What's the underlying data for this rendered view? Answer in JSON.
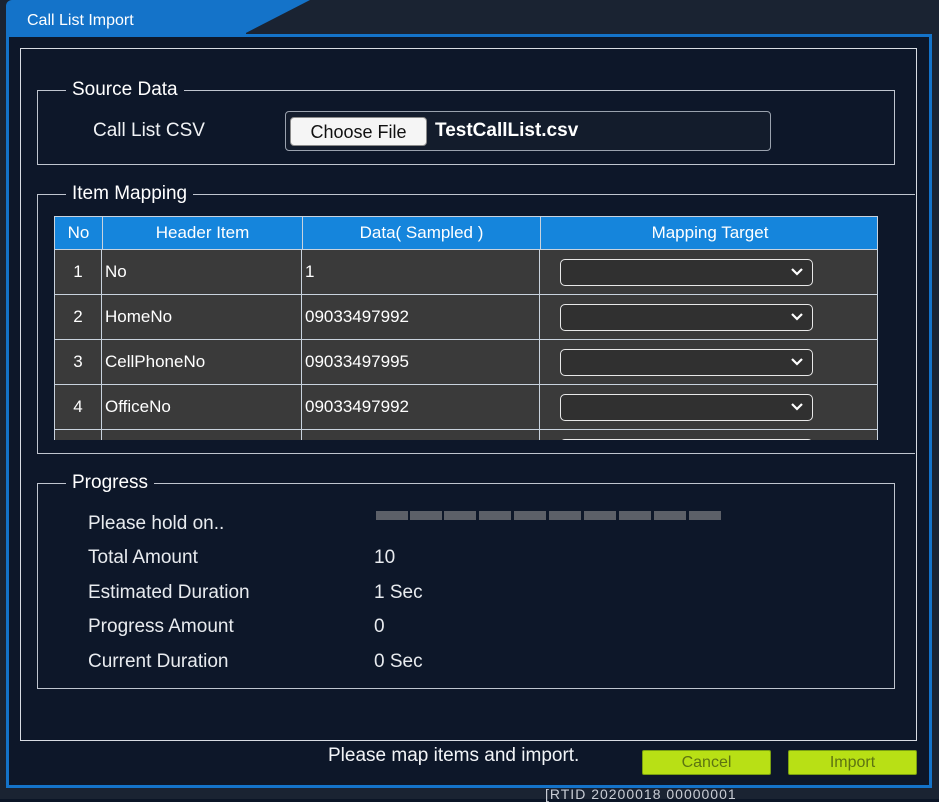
{
  "dialog": {
    "title": "Call List Import"
  },
  "source": {
    "group_title": "Source Data",
    "csv_label": "Call List CSV",
    "choose_file_label": "Choose File",
    "file_name": "TestCallList.csv"
  },
  "mapping": {
    "group_title": "Item Mapping",
    "columns": [
      "No",
      "Header Item",
      "Data( Sampled )",
      "Mapping Target"
    ],
    "rows": [
      {
        "no": "1",
        "header": "No",
        "data": "1",
        "target": ""
      },
      {
        "no": "2",
        "header": "HomeNo",
        "data": "09033497992",
        "target": ""
      },
      {
        "no": "3",
        "header": "CellPhoneNo",
        "data": "09033497995",
        "target": ""
      },
      {
        "no": "4",
        "header": "OfficeNo",
        "data": "09033497992",
        "target": ""
      }
    ]
  },
  "progress": {
    "group_title": "Progress",
    "hold_label": "Please hold on..",
    "total_label": "Total Amount",
    "total_value": "10",
    "estimated_label": "Estimated Duration",
    "estimated_value": "1 Sec",
    "progress_label": "Progress Amount",
    "progress_value": "0",
    "current_label": "Current Duration",
    "current_value": "0 Sec",
    "bar_fraction": 0
  },
  "footer": {
    "status": "Please map items and import.",
    "cancel_label": "Cancel",
    "import_label": "Import"
  },
  "background": {
    "partial_text": "[RTID 20200018 00000001"
  },
  "colors": {
    "accent": "#1473c9",
    "table_header": "#1585dc",
    "button": "#b8e015"
  }
}
